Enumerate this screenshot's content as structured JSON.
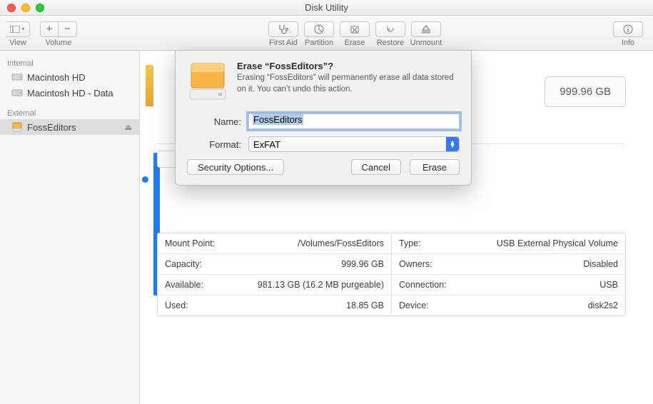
{
  "window": {
    "title": "Disk Utility"
  },
  "toolbar": {
    "view_label": "View",
    "volume_label": "Volume",
    "first_aid": "First Aid",
    "partition": "Partition",
    "erase": "Erase",
    "restore": "Restore",
    "unmount": "Unmount",
    "info": "Info"
  },
  "sidebar": {
    "internal": "Internal",
    "external": "External",
    "items_internal": [
      {
        "label": "Macintosh HD"
      },
      {
        "label": "Macintosh HD - Data"
      }
    ],
    "items_external": [
      {
        "label": "FossEditors"
      }
    ]
  },
  "content": {
    "capacity_display": "999.96 GB",
    "info": {
      "mount_point_k": "Mount Point:",
      "mount_point_v": "/Volumes/FossEditors",
      "capacity_k": "Capacity:",
      "capacity_v": "999.96 GB",
      "available_k": "Available:",
      "available_v": "981.13 GB (16.2 MB purgeable)",
      "used_k": "Used:",
      "used_v": "18.85 GB",
      "type_k": "Type:",
      "type_v": "USB External Physical Volume",
      "owners_k": "Owners:",
      "owners_v": "Disabled",
      "connection_k": "Connection:",
      "connection_v": "USB",
      "device_k": "Device:",
      "device_v": "disk2s2"
    }
  },
  "sheet": {
    "heading": "Erase “FossEditors”?",
    "body": "Erasing “FossEditors” will permanently erase all data stored on it. You can’t undo this action.",
    "name_label": "Name:",
    "name_value": "FossEditors",
    "format_label": "Format:",
    "format_value": "ExFAT",
    "security_btn": "Security Options...",
    "cancel_btn": "Cancel",
    "erase_btn": "Erase"
  }
}
